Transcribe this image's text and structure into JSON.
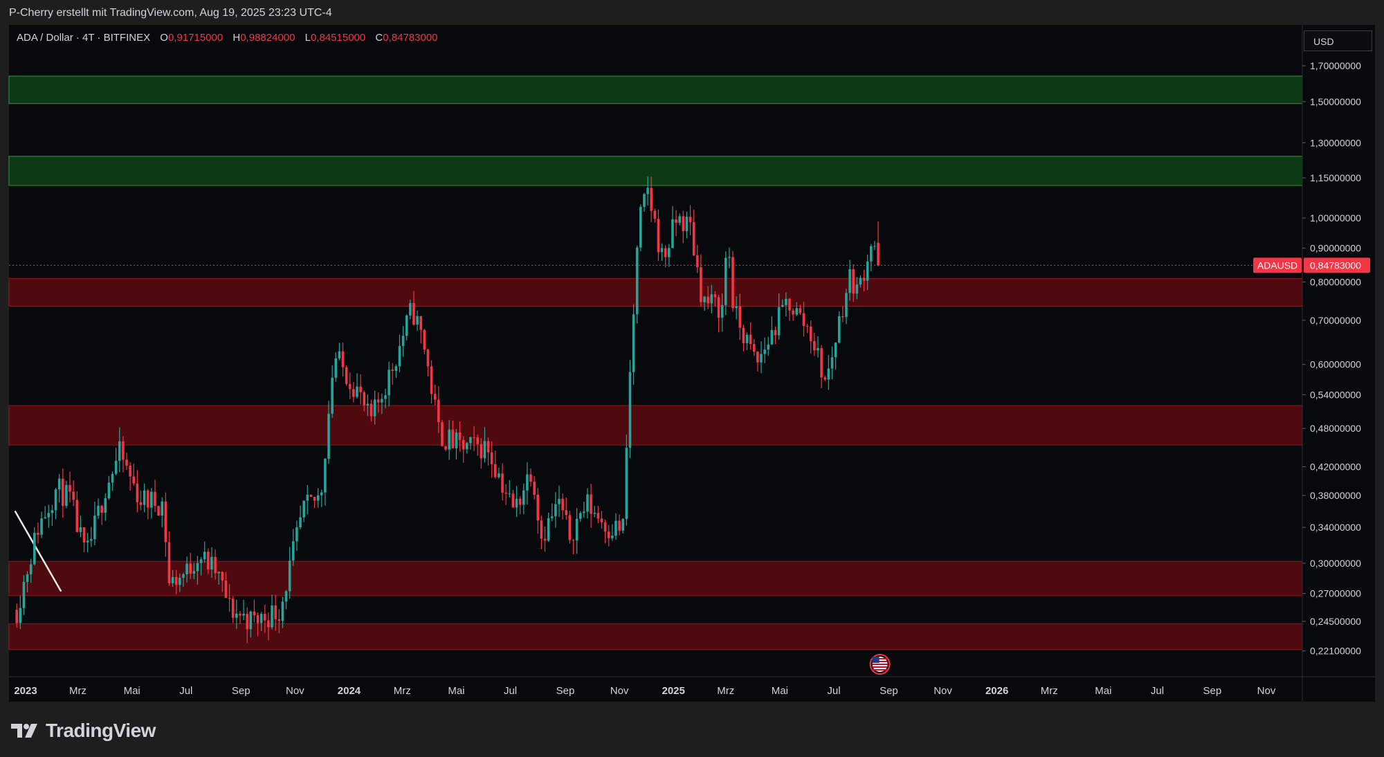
{
  "header": {
    "attribution": "P-Cherry erstellt mit TradingView.com, Aug 19, 2025 23:23 UTC-4"
  },
  "legend": {
    "symbol": "ADA / Dollar · 4T · BITFINEX",
    "open_label": "O",
    "open_value": "0,91715000",
    "high_label": "H",
    "high_value": "0,98824000",
    "low_label": "L",
    "low_value": "0,84515000",
    "close_label": "C",
    "close_value": "0,84783000"
  },
  "currency_button": "USD",
  "price_tag": {
    "symbol": "ADAUSD",
    "value": "0,84783000"
  },
  "footer": {
    "brand": "TradingView"
  },
  "colors": {
    "up": "#26a69a",
    "down": "#f23645",
    "green_zone": "#0b3a14",
    "red_zone": "#5a0a10",
    "background": "#07090d"
  },
  "chart_data": {
    "type": "candlestick",
    "symbol": "ADAUSD",
    "y_scale": "log",
    "ylim": [
      0.205,
      1.88
    ],
    "y_ticks": [
      {
        "value": 1.7,
        "label": "1,70000000"
      },
      {
        "value": 1.5,
        "label": "1,50000000"
      },
      {
        "value": 1.3,
        "label": "1,30000000"
      },
      {
        "value": 1.15,
        "label": "1,15000000"
      },
      {
        "value": 1.0,
        "label": "1,00000000"
      },
      {
        "value": 0.9,
        "label": "0,90000000"
      },
      {
        "value": 0.8,
        "label": "0,80000000"
      },
      {
        "value": 0.7,
        "label": "0,70000000"
      },
      {
        "value": 0.6,
        "label": "0,60000000"
      },
      {
        "value": 0.54,
        "label": "0,54000000"
      },
      {
        "value": 0.48,
        "label": "0,48000000"
      },
      {
        "value": 0.42,
        "label": "0,42000000"
      },
      {
        "value": 0.38,
        "label": "0,38000000"
      },
      {
        "value": 0.34,
        "label": "0,34000000"
      },
      {
        "value": 0.3,
        "label": "0,30000000"
      },
      {
        "value": 0.27,
        "label": "0,27000000"
      },
      {
        "value": 0.245,
        "label": "0,24500000"
      },
      {
        "value": 0.221,
        "label": "0,22100000"
      }
    ],
    "x_ticks": [
      {
        "date": "2023-01",
        "label": "2023",
        "bold": true
      },
      {
        "date": "2023-03",
        "label": "Mrz"
      },
      {
        "date": "2023-05",
        "label": "Mai"
      },
      {
        "date": "2023-07",
        "label": "Jul"
      },
      {
        "date": "2023-09",
        "label": "Sep"
      },
      {
        "date": "2023-11",
        "label": "Nov"
      },
      {
        "date": "2024-01",
        "label": "2024",
        "bold": true
      },
      {
        "date": "2024-03",
        "label": "Mrz"
      },
      {
        "date": "2024-05",
        "label": "Mai"
      },
      {
        "date": "2024-07",
        "label": "Jul"
      },
      {
        "date": "2024-09",
        "label": "Sep"
      },
      {
        "date": "2024-11",
        "label": "Nov"
      },
      {
        "date": "2025-01",
        "label": "2025",
        "bold": true
      },
      {
        "date": "2025-03",
        "label": "Mrz"
      },
      {
        "date": "2025-05",
        "label": "Mai"
      },
      {
        "date": "2025-07",
        "label": "Jul"
      },
      {
        "date": "2025-09",
        "label": "Sep"
      },
      {
        "date": "2025-11",
        "label": "Nov"
      },
      {
        "date": "2026-01",
        "label": "2026",
        "bold": true
      },
      {
        "date": "2026-03",
        "label": "Mrz"
      },
      {
        "date": "2026-05",
        "label": "Mai"
      },
      {
        "date": "2026-07",
        "label": "Jul"
      },
      {
        "date": "2026-09",
        "label": "Sep"
      },
      {
        "date": "2026-11",
        "label": "Nov"
      }
    ],
    "zones": [
      {
        "type": "resistance",
        "color": "green",
        "top": 1.64,
        "bottom": 1.49
      },
      {
        "type": "resistance",
        "color": "green",
        "top": 1.24,
        "bottom": 1.12
      },
      {
        "type": "support",
        "color": "red",
        "top": 0.81,
        "bottom": 0.735
      },
      {
        "type": "support",
        "color": "red",
        "top": 0.52,
        "bottom": 0.453
      },
      {
        "type": "support",
        "color": "red",
        "top": 0.302,
        "bottom": 0.268
      },
      {
        "type": "support",
        "color": "red",
        "top": 0.243,
        "bottom": 0.222
      }
    ],
    "last_price": 0.84783,
    "trend_line": [
      {
        "date": "2022-12-20",
        "price": 0.36
      },
      {
        "date": "2023-02-10",
        "price": 0.272
      }
    ],
    "event_marker": {
      "date": "2025-08-22",
      "flag": "US"
    },
    "candle_interval_days": 4,
    "ohlc_anchor": {
      "date": "2022-12-22",
      "open": 0.255
    },
    "close_path": [
      [
        "2022-12-22",
        0.255
      ],
      [
        "2023-01-15",
        0.34
      ],
      [
        "2023-02-05",
        0.39
      ],
      [
        "2023-02-20",
        0.375
      ],
      [
        "2023-03-10",
        0.305
      ],
      [
        "2023-04-01",
        0.39
      ],
      [
        "2023-04-17",
        0.44
      ],
      [
        "2023-05-10",
        0.375
      ],
      [
        "2023-06-05",
        0.37
      ],
      [
        "2023-06-12",
        0.28
      ],
      [
        "2023-07-01",
        0.29
      ],
      [
        "2023-07-15",
        0.31
      ],
      [
        "2023-08-05",
        0.29
      ],
      [
        "2023-08-20",
        0.255
      ],
      [
        "2023-09-15",
        0.245
      ],
      [
        "2023-10-15",
        0.255
      ],
      [
        "2023-11-10",
        0.36
      ],
      [
        "2023-11-30",
        0.38
      ],
      [
        "2023-12-15",
        0.62
      ],
      [
        "2024-01-10",
        0.55
      ],
      [
        "2024-01-25",
        0.49
      ],
      [
        "2024-02-20",
        0.6
      ],
      [
        "2024-03-12",
        0.73
      ],
      [
        "2024-03-25",
        0.65
      ],
      [
        "2024-04-12",
        0.47
      ],
      [
        "2024-05-05",
        0.45
      ],
      [
        "2024-06-05",
        0.45
      ],
      [
        "2024-07-05",
        0.36
      ],
      [
        "2024-07-25",
        0.42
      ],
      [
        "2024-08-05",
        0.33
      ],
      [
        "2024-08-25",
        0.37
      ],
      [
        "2024-09-05",
        0.33
      ],
      [
        "2024-09-25",
        0.37
      ],
      [
        "2024-10-20",
        0.34
      ],
      [
        "2024-11-05",
        0.34
      ],
      [
        "2024-11-12",
        0.55
      ],
      [
        "2024-11-23",
        0.98
      ],
      [
        "2024-12-03",
        1.1
      ],
      [
        "2024-12-20",
        0.86
      ],
      [
        "2025-01-05",
        1.0
      ],
      [
        "2025-01-20",
        0.97
      ],
      [
        "2025-02-03",
        0.75
      ],
      [
        "2025-02-25",
        0.73
      ],
      [
        "2025-03-03",
        0.95
      ],
      [
        "2025-03-10",
        0.72
      ],
      [
        "2025-04-05",
        0.6
      ],
      [
        "2025-05-10",
        0.75
      ],
      [
        "2025-06-05",
        0.67
      ],
      [
        "2025-06-22",
        0.56
      ],
      [
        "2025-07-10",
        0.73
      ],
      [
        "2025-07-20",
        0.82
      ],
      [
        "2025-07-28",
        0.77
      ],
      [
        "2025-08-14",
        0.94
      ],
      [
        "2025-08-20",
        0.848
      ]
    ]
  }
}
